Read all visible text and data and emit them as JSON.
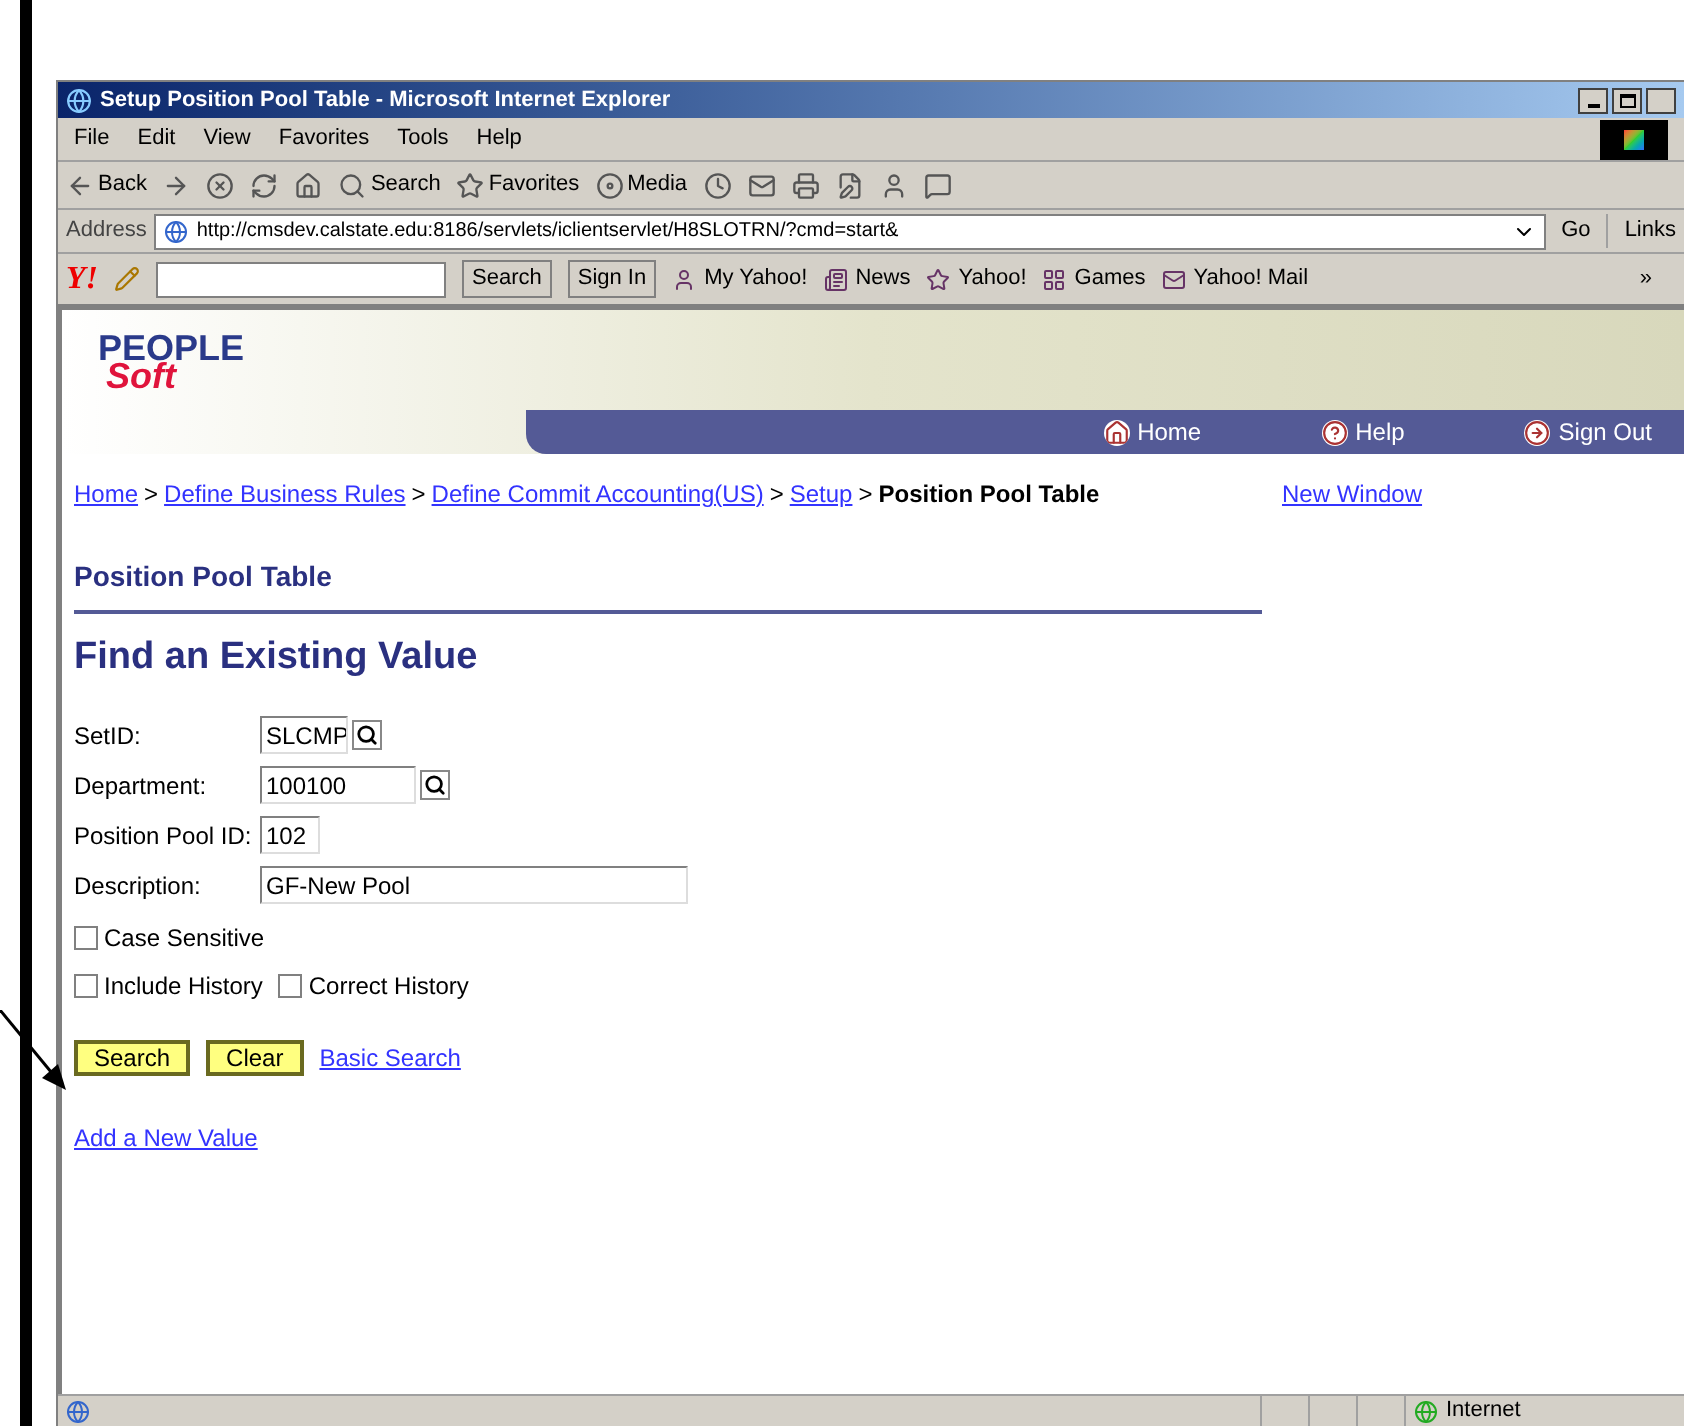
{
  "window": {
    "title": "Setup Position Pool Table - Microsoft Internet Explorer"
  },
  "menu": [
    "File",
    "Edit",
    "View",
    "Favorites",
    "Tools",
    "Help"
  ],
  "toolbar": [
    {
      "kind": "back",
      "label": "Back"
    },
    {
      "kind": "forward"
    },
    {
      "kind": "stop"
    },
    {
      "kind": "refresh"
    },
    {
      "kind": "home"
    },
    {
      "kind": "search",
      "label": "Search"
    },
    {
      "kind": "favorites",
      "label": "Favorites"
    },
    {
      "kind": "media",
      "label": "Media"
    },
    {
      "kind": "history"
    },
    {
      "kind": "mail"
    },
    {
      "kind": "print"
    },
    {
      "kind": "edit"
    },
    {
      "kind": "messenger"
    },
    {
      "kind": "discuss"
    }
  ],
  "address": {
    "label": "Address",
    "url": "http://cmsdev.calstate.edu:8186/servlets/iclientservlet/H8SLOTRN/?cmd=start&",
    "go": "Go",
    "links": "Links"
  },
  "yahoo_bar": {
    "logo": "Y!",
    "search": "Search",
    "sign_in": "Sign In",
    "items": [
      "My Yahoo!",
      "News",
      "Yahoo!",
      "Games",
      "Yahoo! Mail"
    ],
    "more": "»"
  },
  "page": {
    "logo": {
      "top": "PEOPLE",
      "bottom": "Soft"
    },
    "nav": [
      {
        "kind": "home",
        "label": "Home"
      },
      {
        "kind": "help",
        "label": "Help"
      },
      {
        "kind": "signout",
        "label": "Sign Out"
      }
    ],
    "breadcrumb": [
      {
        "label": "Home",
        "link": true
      },
      {
        "separator": ">",
        "label": "Define Business Rules",
        "link": true
      },
      {
        "separator": ">",
        "label": "Define Commit Accounting(US)",
        "link": true
      },
      {
        "separator": ">",
        "label": "Setup",
        "link": true
      },
      {
        "separator": ">",
        "label": "Position Pool Table",
        "link": false
      }
    ],
    "new_window": "New Window",
    "section_title": "Position Pool Table",
    "heading": "Find an Existing Value",
    "fields": [
      {
        "kind": "lookup",
        "label": "SetID:",
        "value": "SLCMP"
      },
      {
        "kind": "lookup",
        "label": "Department:",
        "value": "100100"
      },
      {
        "kind": "text",
        "label": "Position Pool ID:",
        "value": "102"
      },
      {
        "kind": "text",
        "label": "Description:",
        "value": "GF-New Pool"
      }
    ],
    "checkbox_rows": [
      [
        {
          "label": "Case Sensitive",
          "checked": false
        }
      ],
      [
        {
          "label": "Include History",
          "checked": false
        },
        {
          "label": "Correct History",
          "checked": false
        }
      ]
    ],
    "buttons": [
      "Search",
      "Clear"
    ],
    "basic_search": "Basic Search",
    "add_link": "Add a New Value"
  },
  "status_bar": {
    "zone": "Internet"
  }
}
